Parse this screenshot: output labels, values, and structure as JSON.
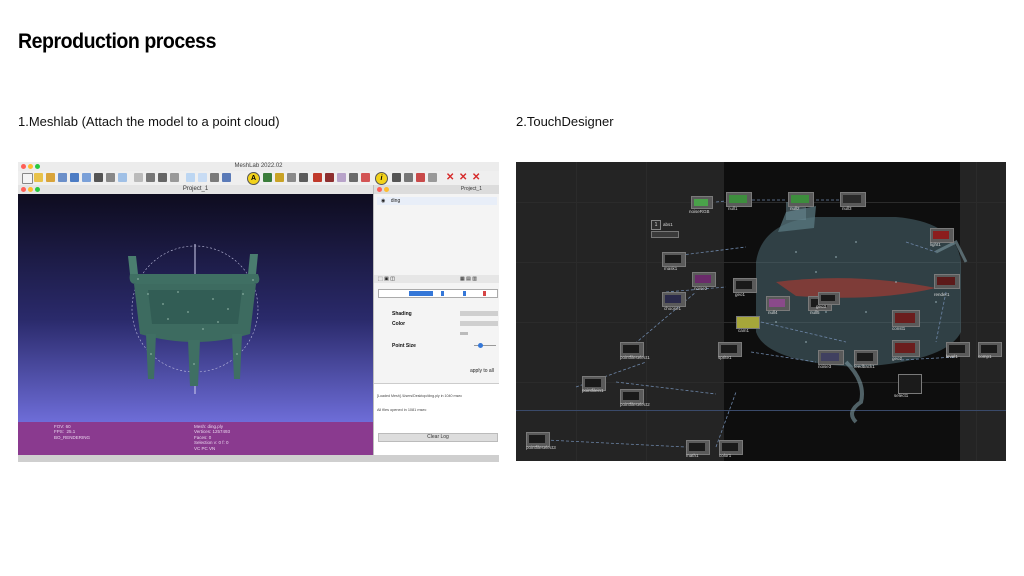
{
  "slide": {
    "title": "Reproduction process",
    "caption_left": "1.Meshlab (Attach the model to a point cloud)",
    "caption_right": "2.TouchDesigner"
  },
  "meshlab": {
    "window_title": "MeshLab 2022.02",
    "project_tab": "Project_1",
    "right_panel_tab": "Project_1",
    "layer_name": "ding",
    "shading_label": "Shading",
    "color_label": "Color",
    "point_size_label": "Point Size",
    "apply_button": "apply to all",
    "log_line_1": "[Loaded Mesh] /Users/Desktop/ding.ply in 1040 msec",
    "log_line_2": "All files opened in 1081 msec",
    "clear_log_button": "Clear Log",
    "info_left": "FOV: 60\nFPS:  25.1\nBO_RENDERING",
    "info_right": "Mesh: ding.ply\nVertices: 1257493\nFaces: 0\nSelection v: 0 f: 0\nVC PC VN"
  },
  "touchdesigner": {
    "counter_label": "abs1",
    "counter_value": "1",
    "nodes": [
      {
        "label": "noiseRGB"
      },
      {
        "label": "null1"
      },
      {
        "label": "null2"
      },
      {
        "label": "null3"
      },
      {
        "label": "mask1"
      },
      {
        "label": "noise2"
      },
      {
        "label": "choose1"
      },
      {
        "label": "geo1"
      },
      {
        "label": "null4"
      },
      {
        "label": "null5"
      },
      {
        "label": "cam1"
      },
      {
        "label": "light1"
      },
      {
        "label": "render1"
      },
      {
        "label": "pointfileselect1"
      },
      {
        "label": "pointfilein1"
      },
      {
        "label": "pointfileselect2"
      },
      {
        "label": "sprite1"
      },
      {
        "label": "noise3"
      },
      {
        "label": "feedback1"
      },
      {
        "label": "level1"
      },
      {
        "label": "comp1"
      },
      {
        "label": "pointfileselect3"
      },
      {
        "label": "math1"
      },
      {
        "label": "color1"
      },
      {
        "label": "geo2"
      },
      {
        "label": "const1"
      },
      {
        "label": "select1"
      },
      {
        "label": "geo3"
      }
    ]
  },
  "colors": {
    "viewport_top": "#0e0c1f",
    "viewport_bottom": "#6e6dd8",
    "info_bar": "#8a3a8f",
    "td_background": "#242424",
    "td_dark_panel": "#0e0e0e"
  }
}
